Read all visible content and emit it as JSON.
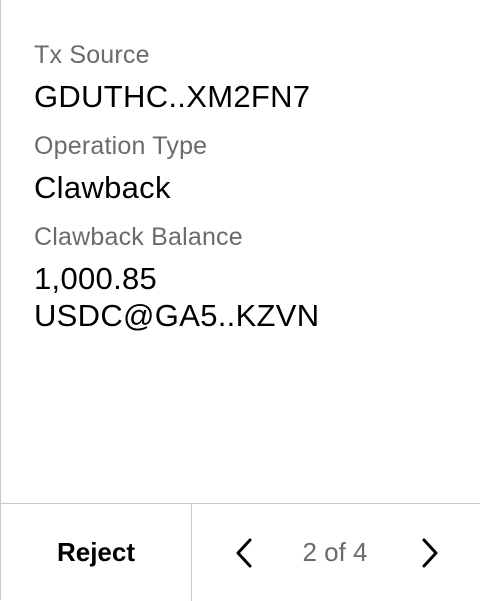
{
  "fields": [
    {
      "label": "Tx Source",
      "value": "GDUTHC..XM2FN7"
    },
    {
      "label": "Operation Type",
      "value": "Clawback"
    },
    {
      "label": "Clawback Balance",
      "value_line1": "1,000.85",
      "value_line2": "USDC@GA5..KZVN"
    }
  ],
  "footer": {
    "reject_label": "Reject",
    "prev_icon": "chevron-left-icon",
    "next_icon": "chevron-right-icon",
    "page_indicator": "2 of 4"
  }
}
